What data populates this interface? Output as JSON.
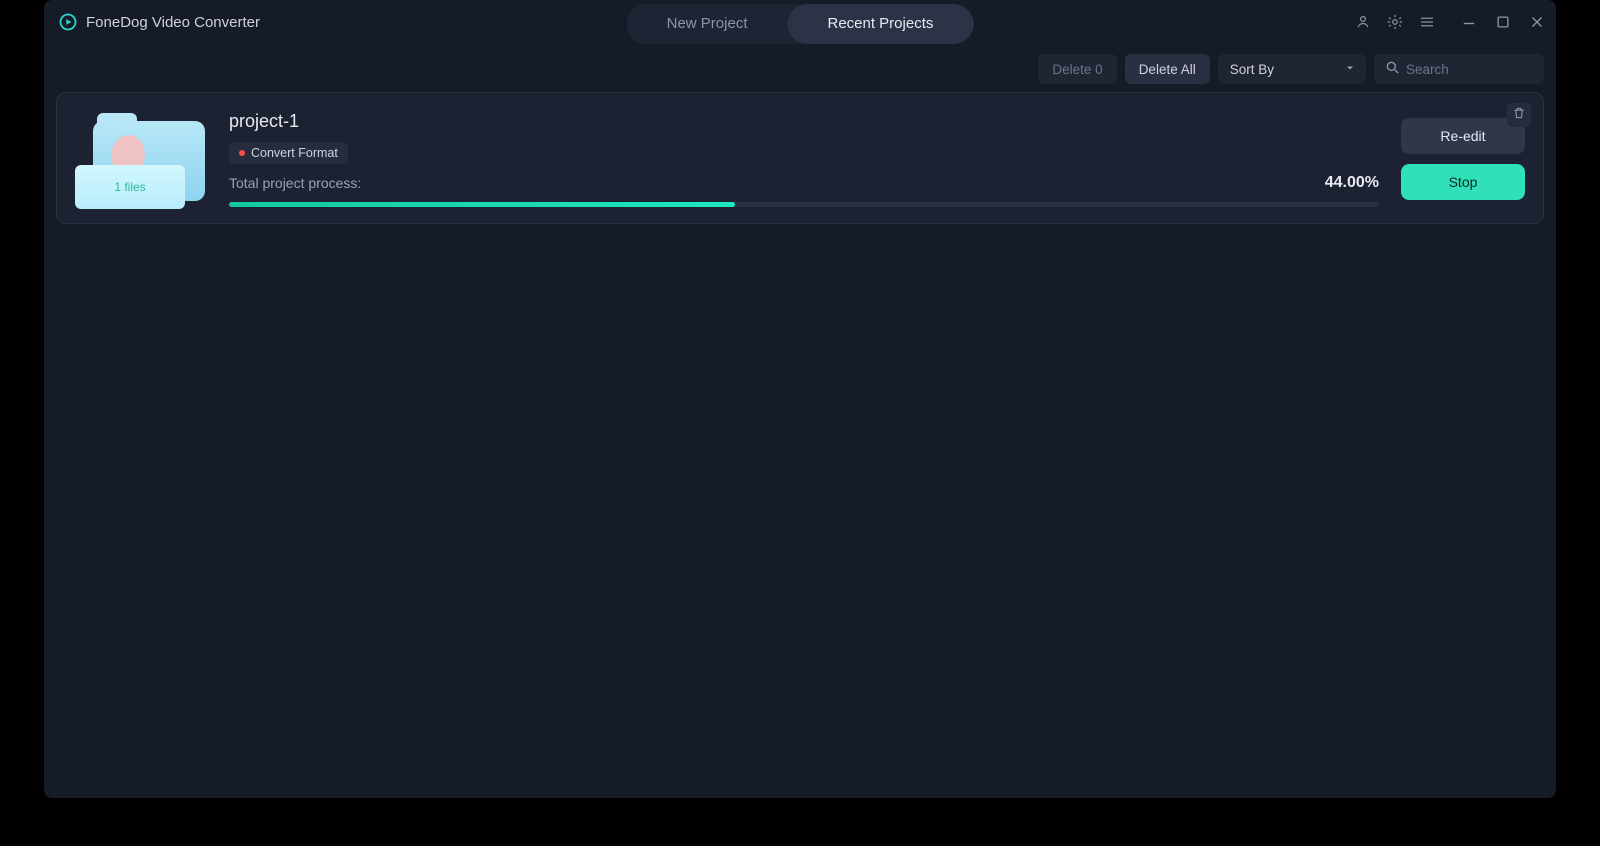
{
  "app": {
    "title": "FoneDog Video Converter"
  },
  "tabs": {
    "new_project": "New Project",
    "recent_projects": "Recent Projects",
    "active": "recent_projects"
  },
  "toolbar": {
    "delete_count_label": "Delete 0",
    "delete_all_label": "Delete All",
    "sort_by_label": "Sort By",
    "search_placeholder": "Search"
  },
  "project": {
    "name": "project-1",
    "tag": "Convert Format",
    "files_badge": "1 files",
    "progress_label": "Total project process:",
    "percent_text": "44.00%",
    "percent_value": 44.0,
    "reedit_label": "Re-edit",
    "stop_label": "Stop"
  },
  "icons": {
    "user": "user-icon",
    "settings": "gear-icon",
    "menu": "menu-icon",
    "minimize": "minimize-icon",
    "maximize": "maximize-icon",
    "close": "close-icon",
    "trash": "trash-icon",
    "search": "search-icon",
    "chevron_down": "chevron-down-icon",
    "logo": "play-circle-icon"
  }
}
